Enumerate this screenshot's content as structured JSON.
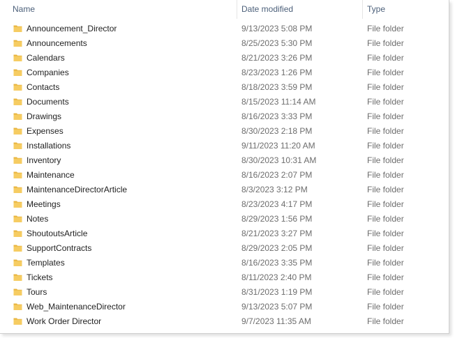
{
  "header": {
    "columns": [
      "Name",
      "Date modified",
      "Type"
    ],
    "sort_indicator": "^"
  },
  "icons": {
    "folder": "folder-icon",
    "folder_color": "#F2C55C"
  },
  "rows": [
    {
      "name": "Announcement_Director",
      "date": "9/13/2023 5:08 PM",
      "type": "File folder"
    },
    {
      "name": "Announcements",
      "date": "8/25/2023 5:30 PM",
      "type": "File folder"
    },
    {
      "name": "Calendars",
      "date": "8/21/2023 3:26 PM",
      "type": "File folder"
    },
    {
      "name": "Companies",
      "date": "8/23/2023 1:26 PM",
      "type": "File folder"
    },
    {
      "name": "Contacts",
      "date": "8/18/2023 3:59 PM",
      "type": "File folder"
    },
    {
      "name": "Documents",
      "date": "8/15/2023 11:14 AM",
      "type": "File folder"
    },
    {
      "name": "Drawings",
      "date": "8/16/2023 3:33 PM",
      "type": "File folder"
    },
    {
      "name": "Expenses",
      "date": "8/30/2023 2:18 PM",
      "type": "File folder"
    },
    {
      "name": "Installations",
      "date": "9/11/2023 11:20 AM",
      "type": "File folder"
    },
    {
      "name": "Inventory",
      "date": "8/30/2023 10:31 AM",
      "type": "File folder"
    },
    {
      "name": "Maintenance",
      "date": "8/16/2023 2:07 PM",
      "type": "File folder"
    },
    {
      "name": "MaintenanceDirectorArticle",
      "date": "8/3/2023 3:12 PM",
      "type": "File folder"
    },
    {
      "name": "Meetings",
      "date": "8/23/2023 4:17 PM",
      "type": "File folder"
    },
    {
      "name": "Notes",
      "date": "8/29/2023 1:56 PM",
      "type": "File folder"
    },
    {
      "name": "ShoutoutsArticle",
      "date": "8/21/2023 3:27 PM",
      "type": "File folder"
    },
    {
      "name": "SupportContracts",
      "date": "8/29/2023 2:05 PM",
      "type": "File folder"
    },
    {
      "name": "Templates",
      "date": "8/16/2023 3:35 PM",
      "type": "File folder"
    },
    {
      "name": "Tickets",
      "date": "8/11/2023 2:40 PM",
      "type": "File folder"
    },
    {
      "name": "Tours",
      "date": "8/31/2023 1:19 PM",
      "type": "File folder"
    },
    {
      "name": "Web_MaintenanceDirector",
      "date": "9/13/2023 5:07 PM",
      "type": "File folder"
    },
    {
      "name": "Work Order Director",
      "date": "9/7/2023 11:35 AM",
      "type": "File folder"
    }
  ]
}
